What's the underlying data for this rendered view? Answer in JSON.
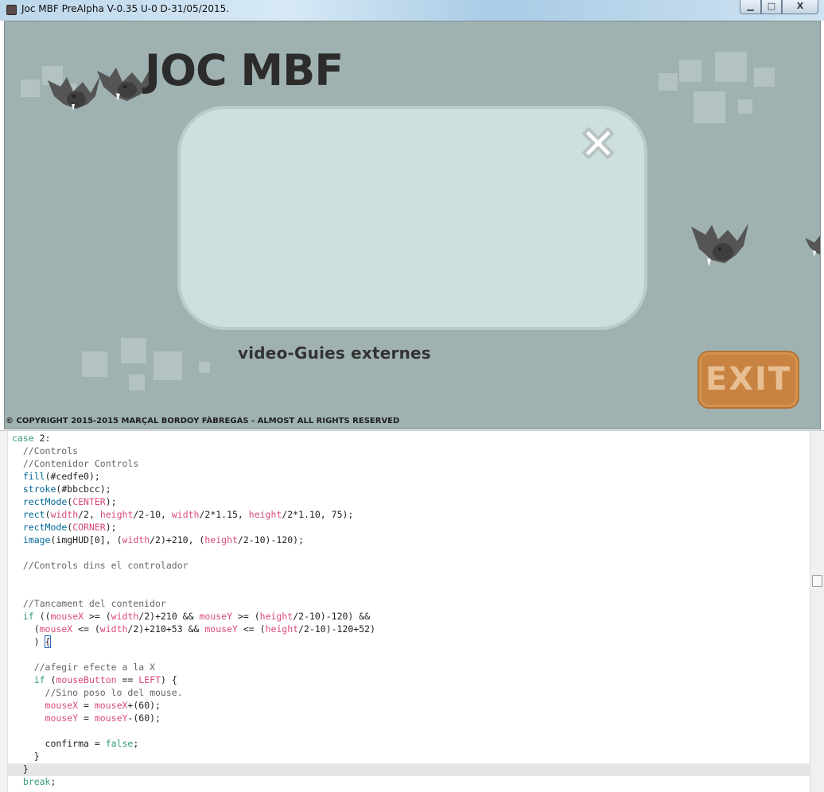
{
  "window": {
    "title": "Joc MBF PreAlpha V-0.35 U-0 D-31/05/2015.",
    "minimize_glyph": "▁",
    "maximize_glyph": "□",
    "close_glyph": "X"
  },
  "game": {
    "title": "JOC MBF",
    "subtitle": "video-Guies externes",
    "exit_label": "EXIT",
    "copyright": "© COPYRIGHT 2015-2015 MARÇAL BORDOY FÀBREGAS - ALMOST ALL RIGHTS RESERVED",
    "icons": [
      "bat-icon",
      "close-x-icon"
    ],
    "colors": {
      "background": "#9fb2b1",
      "panel_fill": "#cedfe0",
      "panel_stroke": "#bbcbcc",
      "exit_button": "#c88342"
    }
  },
  "editor": {
    "lines": [
      "case 2:",
      "  //Controls",
      "  //Contenidor Controls",
      "  fill(#cedfe0);",
      "  stroke(#bbcbcc);",
      "  rectMode(CENTER);",
      "  rect(width/2, height/2-10, width/2*1.15, height/2*1.10, 75);",
      "  rectMode(CORNER);",
      "  image(imgHUD[0], (width/2)+210, (height/2-10)-120);",
      "",
      "  //Controls dins el controlador",
      "",
      "",
      "  //Tancament del contenidor",
      "  if ((mouseX >= (width/2)+210 && mouseY >= (height/2-10)-120) &&",
      "    (mouseX <= (width/2)+210+53 && mouseY <= (height/2-10)-120+52)",
      "    ) {",
      "",
      "    //afegir efecte a la X",
      "    if (mouseButton == LEFT) {",
      "      //Sino poso lo del mouse.",
      "      mouseX = mouseX+(60);",
      "      mouseY = mouseY-(60);",
      "",
      "      confirma = false;",
      "    }",
      "  }",
      "  break;"
    ]
  }
}
